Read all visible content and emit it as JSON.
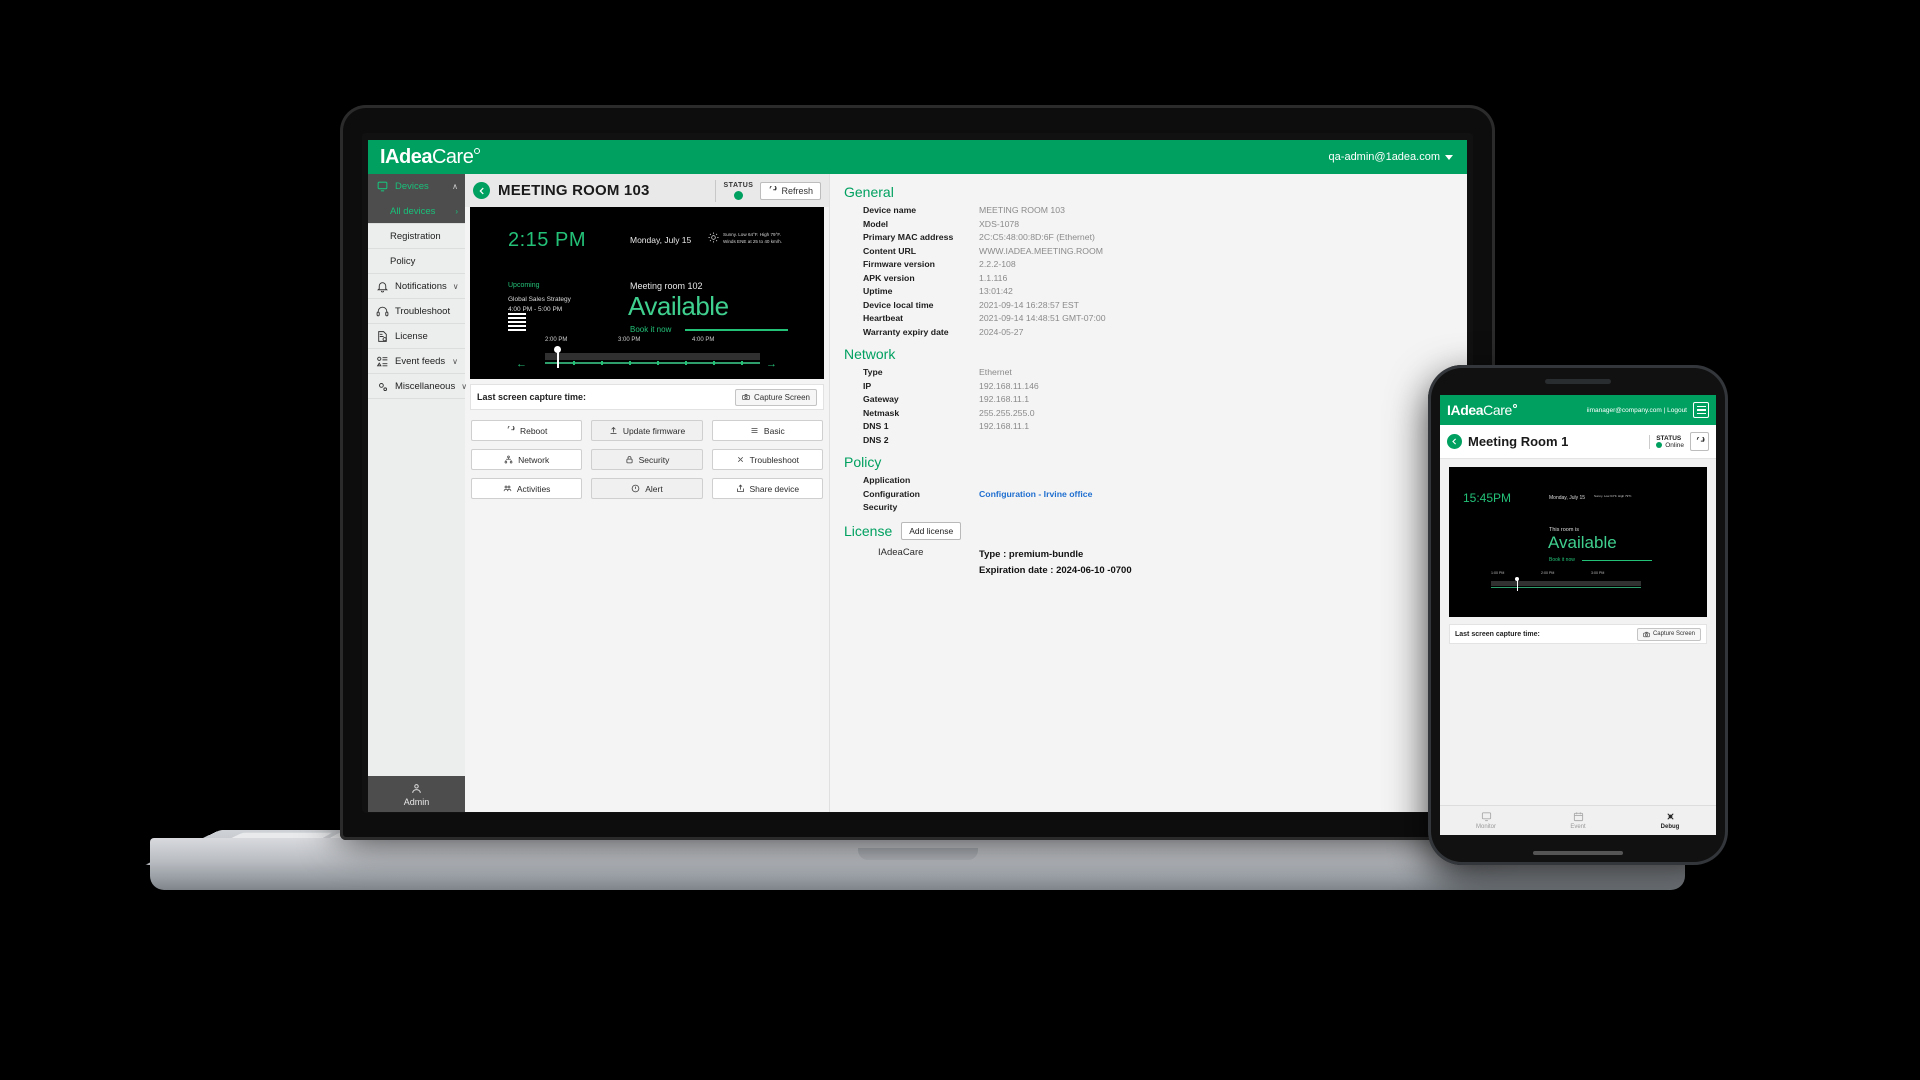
{
  "brand": {
    "name_bold": "IAdea",
    "name_thin": "Care",
    "accent": "#00a060",
    "link": "#1f6fd0"
  },
  "topbar": {
    "account": "qa-admin@1adea.com"
  },
  "sidebar": {
    "items": [
      {
        "label": "Devices",
        "icon": "device-icon",
        "chevron": "∧",
        "state": "expanded"
      },
      {
        "label": "All devices",
        "icon": "",
        "chevron": "›",
        "state": "active-sub"
      },
      {
        "label": "Registration",
        "icon": "",
        "chevron": "",
        "state": "sub"
      },
      {
        "label": "Policy",
        "icon": "",
        "chevron": "",
        "state": "sub"
      },
      {
        "label": "Notifications",
        "icon": "bell-icon",
        "chevron": "∨",
        "state": "normal"
      },
      {
        "label": "Troubleshoot",
        "icon": "headset-icon",
        "chevron": "",
        "state": "normal"
      },
      {
        "label": "License",
        "icon": "license-icon",
        "chevron": "",
        "state": "normal"
      },
      {
        "label": "Event feeds",
        "icon": "feed-icon",
        "chevron": "∨",
        "state": "normal"
      },
      {
        "label": "Miscellaneous",
        "icon": "gears-icon",
        "chevron": "∨",
        "state": "normal"
      }
    ],
    "admin": "Admin"
  },
  "device_header": {
    "title": "MEETING ROOM 103",
    "status_label": "STATUS",
    "refresh_label": "Refresh"
  },
  "preview": {
    "time": "2:15 PM",
    "date": "Monday, July 15",
    "weather_line1": "Sunny. Low 64°F. High 79°F.",
    "weather_line2": "Winds ENE at 25 to 40 km/h.",
    "upcoming_label": "Upcoming",
    "event_title": "Global Sales Strategy",
    "event_time": "4:00 PM - 5:00 PM",
    "room_label": "Meeting room 102",
    "availability": "Available",
    "book_label": "Book it now",
    "timeline_labels": [
      "2:00 PM",
      "3:00 PM",
      "4:00 PM"
    ]
  },
  "capture": {
    "label": "Last screen capture time:",
    "value": "",
    "button": "Capture Screen"
  },
  "actions": {
    "column1": [
      {
        "label": "Reboot",
        "icon": "reboot-icon"
      },
      {
        "label": "Network",
        "icon": "network-icon"
      },
      {
        "label": "Activities",
        "icon": "activities-icon"
      }
    ],
    "column2": [
      {
        "label": "Update firmware",
        "icon": "upload-icon"
      },
      {
        "label": "Security",
        "icon": "lock-icon"
      },
      {
        "label": "Alert",
        "icon": "alert-icon"
      }
    ],
    "column3": [
      {
        "label": "Basic",
        "icon": "list-icon"
      },
      {
        "label": "Troubleshoot",
        "icon": "wrench-icon"
      },
      {
        "label": "Share device",
        "icon": "share-icon"
      }
    ]
  },
  "general": {
    "title": "General",
    "rows": [
      {
        "key": "Device name",
        "value": "MEETING ROOM 103"
      },
      {
        "key": "Model",
        "value": "XDS-1078"
      },
      {
        "key": "Primary MAC address",
        "value": "2C:C5:48:00:8D:6F (Ethernet)"
      },
      {
        "key": "Content URL",
        "value": "WWW.IADEA.MEETING.ROOM"
      },
      {
        "key": "Firmware version",
        "value": "2.2.2-108"
      },
      {
        "key": "APK version",
        "value": "1.1.116"
      },
      {
        "key": "Uptime",
        "value": "13:01:42"
      },
      {
        "key": "Device local time",
        "value": "2021-09-14 16:28:57 EST"
      },
      {
        "key": "Heartbeat",
        "value": "2021-09-14 14:48:51 GMT-07:00"
      },
      {
        "key": "Warranty expiry date",
        "value": "2024-05-27"
      }
    ]
  },
  "network": {
    "title": "Network",
    "rows": [
      {
        "key": "Type",
        "value": "Ethernet"
      },
      {
        "key": "IP",
        "value": "192.168.11.146"
      },
      {
        "key": "Gateway",
        "value": "192.168.11.1"
      },
      {
        "key": "Netmask",
        "value": "255.255.255.0"
      },
      {
        "key": "DNS 1",
        "value": "192.168.11.1"
      },
      {
        "key": "DNS 2",
        "value": ""
      }
    ]
  },
  "policy": {
    "title": "Policy",
    "rows": [
      {
        "key": "Application",
        "value": "",
        "link": false
      },
      {
        "key": "Configuration",
        "value": "Configuration - Irvine office",
        "link": true
      },
      {
        "key": "Security",
        "value": "",
        "link": false
      }
    ]
  },
  "license": {
    "title": "License",
    "add_button": "Add license",
    "name": "IAdeaCare",
    "type_line": "Type : premium-bundle",
    "expiry_line": "Expiration date : 2024-06-10 -0700"
  },
  "phone": {
    "account": "iimanager@company.com | Logout",
    "title": "Meeting Room 1",
    "status_label": "STATUS",
    "status_value": "Online",
    "preview": {
      "time": "15:45PM",
      "date": "Monday, July 15",
      "weather": "Sunny. Low 64°F. High 79°F.",
      "room_label": "This room is",
      "availability": "Available",
      "book_label": "Book it now",
      "timeline_labels": [
        "1:00 PM",
        "2:00 PM",
        "3:00 PM"
      ]
    },
    "capture": {
      "label": "Last screen capture time:",
      "button": "Capture Screen"
    },
    "tabs": [
      {
        "label": "Monitor",
        "icon": "monitor-icon",
        "active": false
      },
      {
        "label": "Event",
        "icon": "event-icon",
        "active": false
      },
      {
        "label": "Debug",
        "icon": "debug-icon",
        "active": true
      }
    ]
  }
}
